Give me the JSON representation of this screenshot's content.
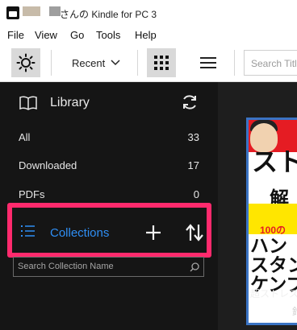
{
  "window": {
    "title": "さんの Kindle for PC 3"
  },
  "menu": {
    "items": [
      "File",
      "View",
      "Go",
      "Tools",
      "Help"
    ]
  },
  "toolbar": {
    "sort_label": "Recent",
    "search_placeholder": "Search Title"
  },
  "sidebar": {
    "library_label": "Library",
    "filters": [
      {
        "label": "All",
        "count": "33"
      },
      {
        "label": "Downloaded",
        "count": "17"
      },
      {
        "label": "PDFs",
        "count": "0"
      }
    ],
    "collections_label": "Collections",
    "collection_search_placeholder": "Search Collection Name"
  },
  "book": {
    "cover_text": "超ストレス解消 ハンコスタンプ",
    "title": "超ストレス解",
    "author": "鈴"
  },
  "colors": {
    "highlight_box": "#ff2a6d",
    "collections_accent": "#2f8ff5",
    "sidebar_bg": "#151515",
    "selected_view_bg": "#d9d9d9"
  },
  "icons": [
    "kindle-logo-icon",
    "sun-icon",
    "chevron-down-icon",
    "grid-icon",
    "list-icon",
    "book-open-icon",
    "sync-icon",
    "list-icon",
    "plus-icon",
    "sort-arrows-icon",
    "search-icon"
  ]
}
